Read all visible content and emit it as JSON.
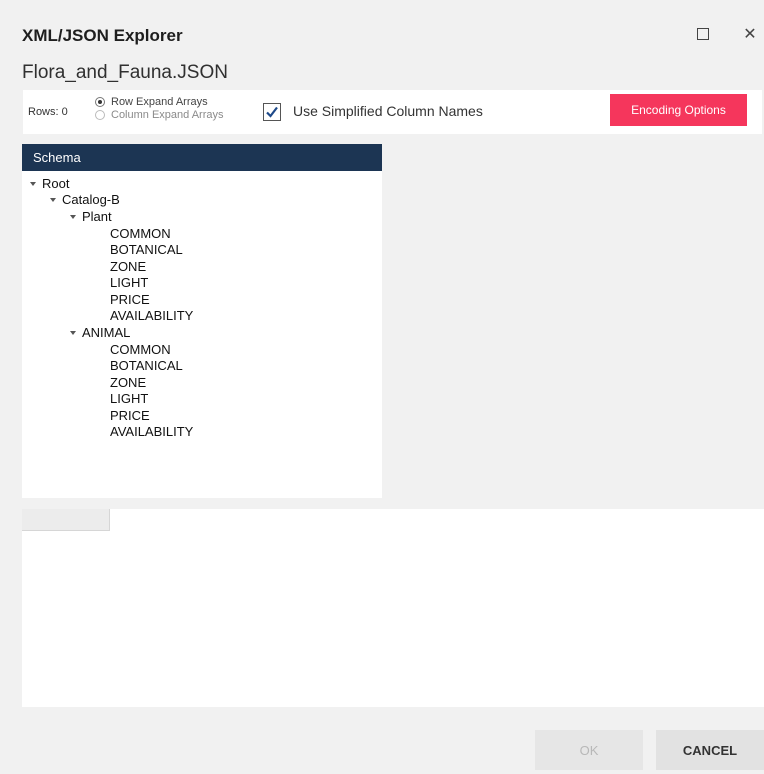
{
  "window": {
    "title": "XML/JSON Explorer",
    "close_glyph": "✕"
  },
  "file": {
    "name": "Flora_and_Fauna.JSON"
  },
  "toolbar": {
    "rows_label": "Rows: 0",
    "radio_row_expand": "Row Expand Arrays",
    "radio_column_expand": "Column Expand Arrays",
    "selected_mode": "Row Expand Arrays",
    "simplified_names_checked": true,
    "simplified_names_label": "Use Simplified Column Names",
    "encoding_button": "Encoding Options"
  },
  "schema": {
    "header": "Schema",
    "nodes": [
      {
        "label": "Root"
      },
      {
        "label": "Catalog-B"
      },
      {
        "label": "Plant"
      },
      {
        "label": "COMMON"
      },
      {
        "label": "BOTANICAL"
      },
      {
        "label": "ZONE"
      },
      {
        "label": "LIGHT"
      },
      {
        "label": "PRICE"
      },
      {
        "label": "AVAILABILITY"
      },
      {
        "label": "ANIMAL"
      },
      {
        "label": "COMMON"
      },
      {
        "label": "BOTANICAL"
      },
      {
        "label": "ZONE"
      },
      {
        "label": "LIGHT"
      },
      {
        "label": "PRICE"
      },
      {
        "label": "AVAILABILITY"
      }
    ]
  },
  "footer": {
    "ok_label": "OK",
    "cancel_label": "CANCEL"
  },
  "colors": {
    "accent": "#f5365c",
    "schema_header_bg": "#1c3553"
  }
}
